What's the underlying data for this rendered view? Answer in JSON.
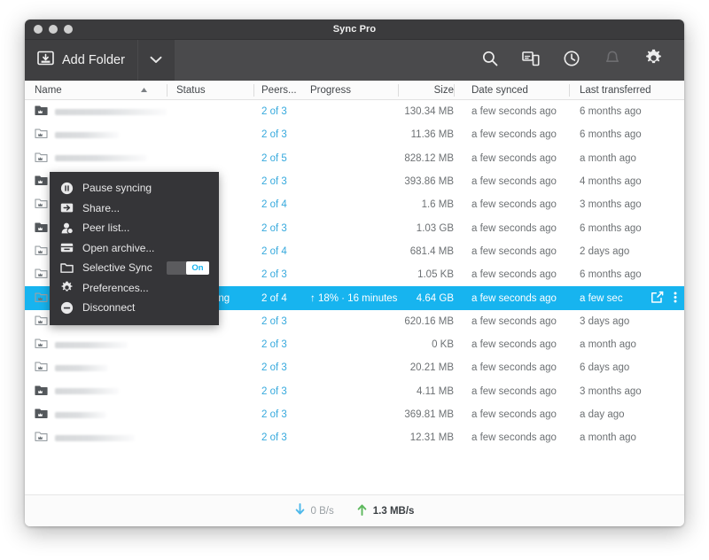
{
  "window": {
    "title": "Sync Pro",
    "traffic_lights": [
      "close",
      "minimize",
      "zoom"
    ]
  },
  "toolbar": {
    "add_folder_label": "Add Folder",
    "add_folder_icon": "folder-download-icon",
    "caret_icon": "chevron-down-icon",
    "icons": [
      {
        "name": "search-icon",
        "label": "Search"
      },
      {
        "name": "devices-icon",
        "label": "Devices"
      },
      {
        "name": "history-icon",
        "label": "History"
      },
      {
        "name": "bell-icon",
        "label": "Notifications"
      },
      {
        "name": "gear-icon",
        "label": "Settings"
      }
    ]
  },
  "table": {
    "columns": [
      "Name",
      "Status",
      "Peers...",
      "Progress",
      "Size",
      "Date synced",
      "Last transferred"
    ],
    "sort": {
      "column": "Name",
      "direction": "asc",
      "glyph": "▲"
    },
    "rows": [
      {
        "folder": "dark",
        "name_width": 128,
        "status": "",
        "peers": "2 of 3",
        "progress": "",
        "size": "130.34 MB",
        "date_synced": "a few seconds ago",
        "last_transferred": "6 months ago",
        "selected": false
      },
      {
        "folder": "light",
        "name_width": 72,
        "status": "",
        "peers": "2 of 3",
        "progress": "",
        "size": "11.36 MB",
        "date_synced": "a few seconds ago",
        "last_transferred": "6 months ago",
        "selected": false
      },
      {
        "folder": "light",
        "name_width": 104,
        "status": "",
        "peers": "2 of 5",
        "progress": "",
        "size": "828.12 MB",
        "date_synced": "a few seconds ago",
        "last_transferred": "a month ago",
        "selected": false
      },
      {
        "folder": "dark",
        "name_width": 88,
        "status": "",
        "peers": "2 of 3",
        "progress": "",
        "size": "393.86 MB",
        "date_synced": "a few seconds ago",
        "last_transferred": "4 months ago",
        "selected": false
      },
      {
        "folder": "light",
        "name_width": 116,
        "status": "",
        "peers": "2 of 4",
        "progress": "",
        "size": "1.6 MB",
        "date_synced": "a few seconds ago",
        "last_transferred": "3 months ago",
        "selected": false
      },
      {
        "folder": "dark",
        "name_width": 80,
        "status": "",
        "peers": "2 of 3",
        "progress": "",
        "size": "1.03 GB",
        "date_synced": "a few seconds ago",
        "last_transferred": "6 months ago",
        "selected": false
      },
      {
        "folder": "light",
        "name_width": 96,
        "status": "",
        "peers": "2 of 4",
        "progress": "",
        "size": "681.4 MB",
        "date_synced": "a few seconds ago",
        "last_transferred": "2 days ago",
        "selected": false
      },
      {
        "folder": "light",
        "name_width": 110,
        "status": "",
        "peers": "2 of 3",
        "progress": "",
        "size": "1.05 KB",
        "date_synced": "a few seconds ago",
        "last_transferred": "6 months ago",
        "selected": false
      },
      {
        "folder": "light",
        "name_width": 76,
        "status": "Sending",
        "peers": "2 of 4",
        "progress": "↑ 18% · 16 minutes",
        "size": "4.64 GB",
        "date_synced": "a few seconds ago",
        "last_transferred": "a few sec",
        "selected": true
      },
      {
        "folder": "light",
        "name_width": 62,
        "status": "",
        "peers": "2 of 3",
        "progress": "",
        "size": "620.16 MB",
        "date_synced": "a few seconds ago",
        "last_transferred": "3 days ago",
        "selected": false
      },
      {
        "folder": "light",
        "name_width": 82,
        "status": "",
        "peers": "2 of 3",
        "progress": "",
        "size": "0 KB",
        "date_synced": "a few seconds ago",
        "last_transferred": "a month ago",
        "selected": false
      },
      {
        "folder": "light",
        "name_width": 60,
        "status": "",
        "peers": "2 of 3",
        "progress": "",
        "size": "20.21 MB",
        "date_synced": "a few seconds ago",
        "last_transferred": "6 days ago",
        "selected": false
      },
      {
        "folder": "dark",
        "name_width": 72,
        "status": "",
        "peers": "2 of 3",
        "progress": "",
        "size": "4.11 MB",
        "date_synced": "a few seconds ago",
        "last_transferred": "3 months ago",
        "selected": false
      },
      {
        "folder": "dark",
        "name_width": 58,
        "status": "",
        "peers": "2 of 3",
        "progress": "",
        "size": "369.81 MB",
        "date_synced": "a few seconds ago",
        "last_transferred": "a day ago",
        "selected": false
      },
      {
        "folder": "light",
        "name_width": 90,
        "status": "",
        "peers": "2 of 3",
        "progress": "",
        "size": "12.31 MB",
        "date_synced": "a few seconds ago",
        "last_transferred": "a month ago",
        "selected": false
      }
    ],
    "row_actions": [
      {
        "name": "share-row-icon",
        "label": "Share"
      },
      {
        "name": "more-options-icon",
        "label": "More"
      }
    ]
  },
  "context_menu": {
    "items": [
      {
        "icon": "pause-circle-icon",
        "label": "Pause syncing",
        "toggle": null
      },
      {
        "icon": "share-icon",
        "label": "Share...",
        "toggle": null
      },
      {
        "icon": "person-icon",
        "label": "Peer list...",
        "toggle": null
      },
      {
        "icon": "archive-icon",
        "label": "Open archive...",
        "toggle": null
      },
      {
        "icon": "folder-icon",
        "label": "Selective Sync",
        "toggle": "On"
      },
      {
        "icon": "gear-icon",
        "label": "Preferences...",
        "toggle": null
      },
      {
        "icon": "minus-circle-icon",
        "label": "Disconnect",
        "toggle": null
      }
    ]
  },
  "status_bar": {
    "download": {
      "icon": "arrow-down-icon",
      "value": "0 B/s"
    },
    "upload": {
      "icon": "arrow-up-icon",
      "value": "1.3 MB/s"
    }
  },
  "colors": {
    "accent": "#17b4ef",
    "peers_link": "#36a9dd",
    "upload_arrow": "#5cb85c",
    "download_arrow": "#4cb8ea",
    "titlebar": "#3b3b3d",
    "toolbar": "#4a4a4c",
    "menu_bg": "#353538"
  }
}
